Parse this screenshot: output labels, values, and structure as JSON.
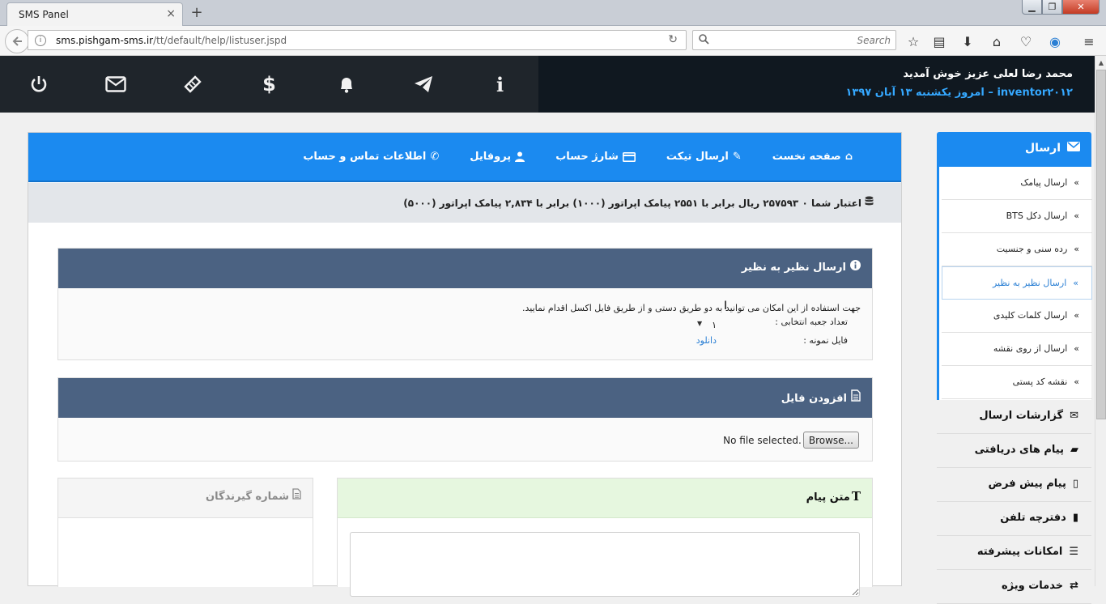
{
  "browser": {
    "tab_title": "SMS Panel",
    "tab_close": "×",
    "new_tab": "+",
    "win_min": "▁",
    "win_max": "❐",
    "win_close": "✕",
    "url_host": "sms.pishgam-sms.ir",
    "url_path": "/tt/default/help/listuser.jspd",
    "search_placeholder": "Search"
  },
  "header": {
    "greeting": "محمد رضا لعلی عزیز خوش آمدید",
    "dateline": "inventor۲۰۱۲ – امروز یکشنبه ۱۳ آبان ۱۳۹۷",
    "icons": [
      "power-icon",
      "envelope-icon",
      "ticket-icon",
      "dollar-icon",
      "bell-icon",
      "paper-plane-icon",
      "info-icon"
    ]
  },
  "topnav": {
    "home": "صفحه نخست",
    "ticket": "ارسال تیکت",
    "charge": "شارژ حساب",
    "profile": "پروفایل",
    "contact": "اطلاعات تماس و حساب"
  },
  "credit": "اعتبار شما ۰ ۲۵۷۵۹۳ ریال برابر با ۲۵۵۱ پیامک اپراتور (۱۰۰۰) برابر با ۲,۸۳۴ پیامک اپراتور (۵۰۰۰)",
  "sidebar": {
    "header": "ارسال",
    "sub": [
      "ارسال پیامک",
      "ارسال دکل BTS",
      "رده سنی و جنسیت",
      "ارسال نظیر به نظیر",
      "ارسال کلمات کلیدی",
      "ارسال از روی نقشه",
      "نقشه کد پستی"
    ],
    "main": [
      "گزارشات ارسال",
      "پیام های دریافتی",
      "پیام پیش فرض",
      "دفترچه تلفن",
      "امکانات پیشرفته",
      "خدمات ویژه"
    ]
  },
  "panel_p2p": {
    "title": "ارسال نظیر به نظیر",
    "description": "جهت استفاده از این امکان می توانید به دو طریق دستی و از طریق فایل اکسل اقدام نمایید.",
    "count_label": "تعداد جعبه انتخابی :",
    "count_value": "۱",
    "sample_label": "فایل نمونه :",
    "download": "دانلود"
  },
  "panel_file": {
    "title": "افزودن فایل",
    "browse": "Browse...",
    "status": "No file selected."
  },
  "panel_message": {
    "title": "متن پیام",
    "text": ""
  },
  "panel_recipients": {
    "title": "شماره گیرندگان"
  },
  "colors": {
    "accent": "#1b8af0",
    "panel_head": "#4b6282",
    "header_bg": "#101820"
  }
}
